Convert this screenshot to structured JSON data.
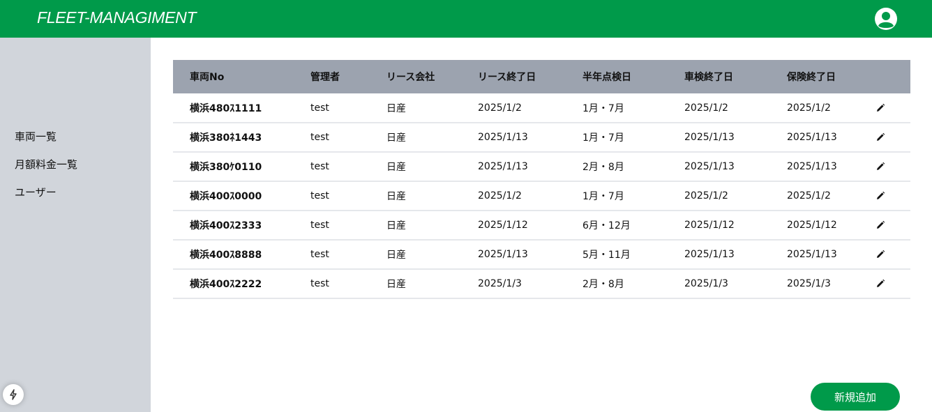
{
  "header": {
    "brand": "FLEET-MANAGIMENT",
    "color": "#009a4a",
    "avatar_icon": "user-circle-icon"
  },
  "sidebar": {
    "items": [
      {
        "label": "車両一覧"
      },
      {
        "label": "月額料金一覧"
      },
      {
        "label": "ユーザー"
      }
    ]
  },
  "table": {
    "columns": [
      "車両No",
      "管理者",
      "リース会社",
      "リース終了日",
      "半年点検日",
      "車検終了日",
      "保険終了日"
    ],
    "rows": [
      [
        "横浜480ｽ1111",
        "test",
        "日産",
        "2025/1/2",
        "1月・7月",
        "2025/1/2",
        "2025/1/2"
      ],
      [
        "横浜380ﾈ1443",
        "test",
        "日産",
        "2025/1/13",
        "1月・7月",
        "2025/1/13",
        "2025/1/13"
      ],
      [
        "横浜380ｹ0110",
        "test",
        "日産",
        "2025/1/13",
        "2月・8月",
        "2025/1/13",
        "2025/1/13"
      ],
      [
        "横浜400ｽ0000",
        "test",
        "日産",
        "2025/1/2",
        "1月・7月",
        "2025/1/2",
        "2025/1/2"
      ],
      [
        "横浜400ｽ2333",
        "test",
        "日産",
        "2025/1/12",
        "6月・12月",
        "2025/1/12",
        "2025/1/12"
      ],
      [
        "横浜400ｽ8888",
        "test",
        "日産",
        "2025/1/13",
        "5月・11月",
        "2025/1/13",
        "2025/1/13"
      ],
      [
        "横浜400ｽ2222",
        "test",
        "日産",
        "2025/1/3",
        "2月・8月",
        "2025/1/3",
        "2025/1/3"
      ]
    ],
    "row_action_icon": "pencil-icon"
  },
  "actions": {
    "add_label": "新規追加"
  }
}
